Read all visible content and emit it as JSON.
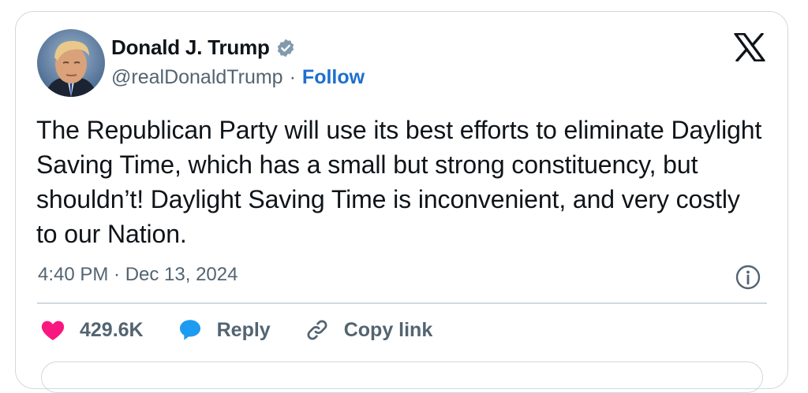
{
  "author": {
    "name": "Donald J. Trump",
    "handle": "@realDonaldTrump",
    "separator": "·",
    "follow_label": "Follow",
    "verified_color": "#829aab"
  },
  "brand_icon": "x-logo-icon",
  "tweet": {
    "text": "The Republican Party will use its best efforts to eliminate Daylight Saving Time, which has a small but strong constituency, but shouldn’t! Daylight Saving Time is inconvenient, and very costly to our Nation.",
    "timestamp": "4:40 PM · Dec 13, 2024"
  },
  "actions": {
    "likes": {
      "icon": "heart-icon",
      "label": "429.6K",
      "color": "#f91880"
    },
    "reply": {
      "icon": "reply-bubble-icon",
      "label": "Reply",
      "color": "#1d9bf0"
    },
    "copy_link": {
      "icon": "link-icon",
      "label": "Copy link"
    }
  },
  "colors": {
    "accent": "#1d6fd0",
    "secondary_text": "#536471",
    "border": "#cfd9de"
  }
}
